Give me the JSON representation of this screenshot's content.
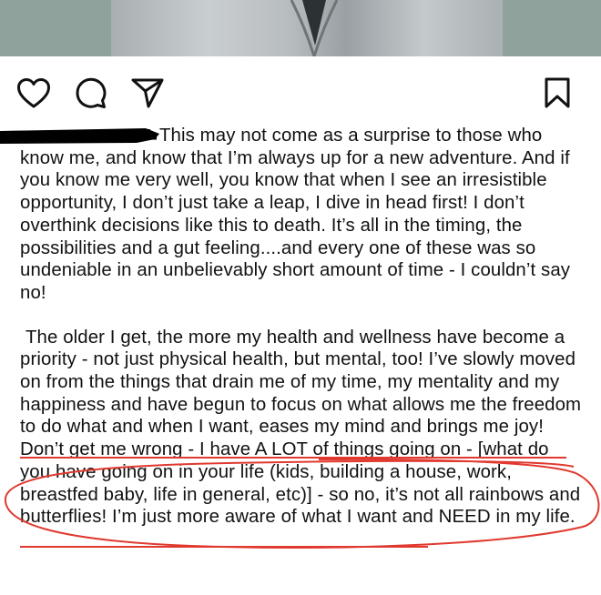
{
  "post": {
    "actions": {
      "like_icon": "heart-icon",
      "comment_icon": "comment-icon",
      "share_icon": "send-icon",
      "save_icon": "bookmark-icon"
    },
    "caption": {
      "paragraph1": "This may not come as a surprise to those who know me, and know that I’m always up for a new adventure. And if you know me very well, you know that when I see an irresistible opportunity, I don’t just take a leap, I dive in head first! I don’t overthink decisions like this to death. It’s all in the timing, the possibilities and a gut feeling....and every one of these was so undeniable in an unbelievably short amount of time - I couldn’t say no!",
      "paragraph2": "The older I get, the more my health and wellness have become a priority - not just physical health, but mental, too! I’ve slowly moved on from the things that drain me of my time, my mentality and my happiness and have begun to focus on what allows me the freedom to do what and when I want, eases my mind and brings me joy! Don’t get me wrong - I have A LOT of things going on - [what do you have going on in your life (kids, building a house, work, breastfed baby, life in general, etc)] - so no, it’s not all rainbows and butterflies! I’m just more aware of what I want and NEED in my life."
    }
  },
  "colors": {
    "text": "#111111",
    "annotation": "#e0392f",
    "strike": "#e0392f",
    "redaction": "#000000"
  }
}
